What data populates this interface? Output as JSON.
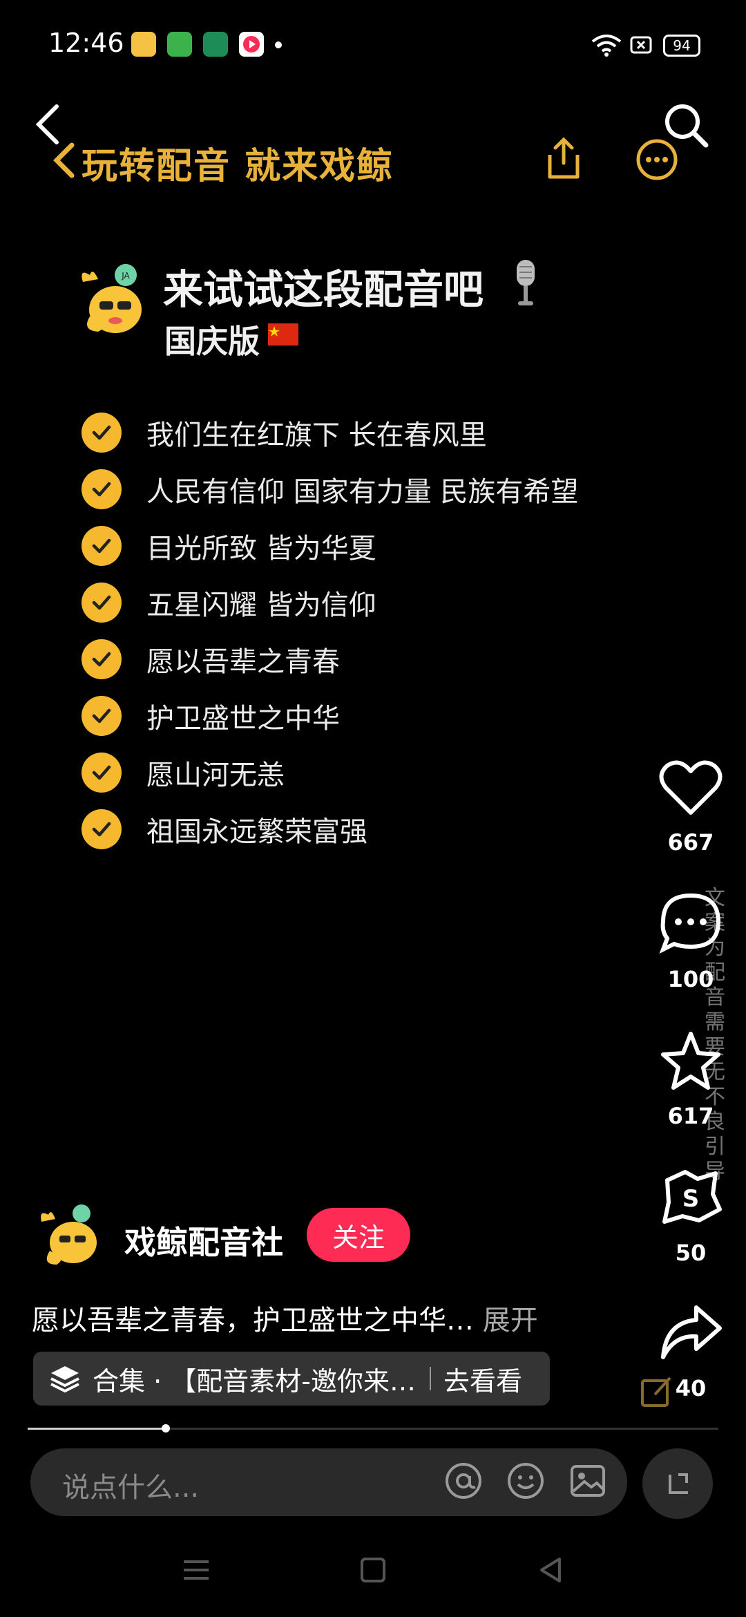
{
  "status_bar": {
    "time": "12:46",
    "battery": "94",
    "app_icons": [
      "wallet-app-icon",
      "iqiyi-app-icon",
      "oppo-app-icon",
      "video-app-icon"
    ],
    "system_icons": [
      "wifi-icon",
      "sim-icon",
      "battery-icon"
    ]
  },
  "banner": {
    "text": "玩转配音 就来戏鲸"
  },
  "content": {
    "title": "来试试这段配音吧",
    "subtitle": "国庆版",
    "lines": [
      "我们生在红旗下 长在春风里",
      "人民有信仰 国家有力量 民族有希望",
      "目光所致 皆为华夏",
      "五星闪耀 皆为信仰",
      "愿以吾辈之青春",
      "护卫盛世之中华",
      "愿山河无恙",
      "祖国永远繁荣富强"
    ]
  },
  "rail": {
    "likes": "667",
    "comments": "100",
    "favorites": "617",
    "dubs": "50",
    "shares": "40",
    "vertical_text": "文案为配音需要 无不良引导"
  },
  "author": {
    "name": "戏鲸配音社",
    "follow_label": "关注"
  },
  "caption": {
    "text": "愿以吾辈之青春，护卫盛世之中华…",
    "more_label": "展开"
  },
  "collection": {
    "text": "合集 · 【配音素材-邀你来…",
    "go_label": "去看看"
  },
  "progress": {
    "value": 0.2
  },
  "comment_input": {
    "placeholder": "说点什么..."
  },
  "colors": {
    "accent_gold": "#E8B23A",
    "check_yellow": "#F5B82E",
    "follow_red": "#FE2C55"
  }
}
